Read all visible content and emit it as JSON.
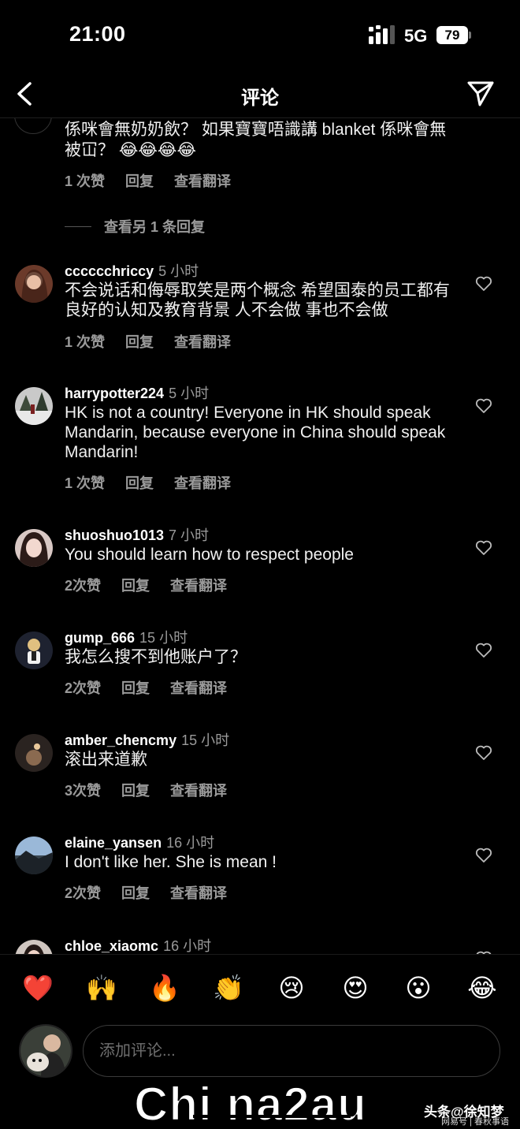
{
  "status_bar": {
    "time": "21:00",
    "network": "5G",
    "battery": "79"
  },
  "header": {
    "title": "评论"
  },
  "truncated_comment": {
    "text": "係咪會無奶奶飲？ 如果寶寶唔識講 blanket 係咪會無被冚？ 😂😂😂😂",
    "likes": "1 次赞",
    "reply": "回复",
    "translate": "查看翻译",
    "view_more_replies": "查看另 1 条回复"
  },
  "comments": [
    {
      "user": "cccccchriccy",
      "time": "5 小时",
      "text": "不会说话和侮辱取笑是两个概念 希望国泰的员工都有良好的认知及教育背景 人不会做 事也不会做",
      "likes": "1 次赞",
      "reply": "回复",
      "translate": "查看翻译"
    },
    {
      "user": "harrypotter224",
      "time": "5 小时",
      "text": "HK is not a country! Everyone in HK should speak Mandarin, because everyone in China should speak Mandarin!",
      "likes": "1 次赞",
      "reply": "回复",
      "translate": "查看翻译"
    },
    {
      "user": "shuoshuo1013",
      "time": "7 小时",
      "text": "You should learn how to respect people",
      "likes": "2次赞",
      "reply": "回复",
      "translate": "查看翻译"
    },
    {
      "user": "gump_666",
      "time": "15 小时",
      "text": "我怎么搜不到他账户了？",
      "likes": "2次赞",
      "reply": "回复",
      "translate": "查看翻译"
    },
    {
      "user": "amber_chencmy",
      "time": "15 小时",
      "text": "滚出来道歉",
      "likes": "3次赞",
      "reply": "回复",
      "translate": "查看翻译"
    },
    {
      "user": "elaine_yansen",
      "time": "16 小时",
      "text": "I don't like her. She is mean !",
      "likes": "2次赞",
      "reply": "回复",
      "translate": "查看翻译"
    },
    {
      "user": "chloe_xiaomc",
      "time": "16 小时",
      "text": "",
      "likes": "",
      "reply": "",
      "translate": ""
    }
  ],
  "emoji_bar": [
    "❤️",
    "🙌",
    "🔥",
    "👏",
    "😢",
    "😍",
    "😮",
    "😂"
  ],
  "composer": {
    "placeholder": "添加评论..."
  },
  "watermark": {
    "main": "Chi na2au",
    "right": "头条@徐知梦",
    "sub": "网易号 | 春秋事语"
  }
}
